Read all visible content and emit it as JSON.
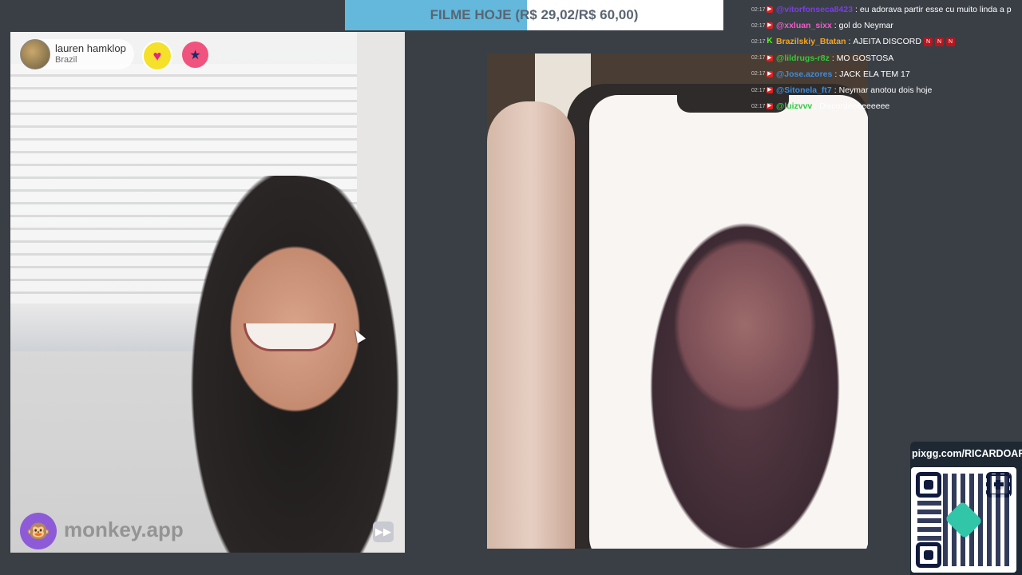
{
  "goal": {
    "text": "FILME HOJE (R$ 29,02/R$ 60,00)",
    "progress_fraction": 0.48,
    "fill_color": "#63b8dc"
  },
  "stranger": {
    "name": "lauren hamklop",
    "country": "Brazil",
    "avatar_icon": "monkey-avatar-icon",
    "heart_icon": "heart-icon",
    "report_icon": "police-icon"
  },
  "app": {
    "logo_icon": "monkey-logo-icon",
    "name": "monkey.app",
    "skip_icon": "skip-forward-icon"
  },
  "chat": [
    {
      "time": "02:17",
      "platform": "youtube",
      "user": "@vitorfonseca8423",
      "user_color": "#7b3fe0",
      "message": "eu adorava partir esse cu muito linda a p",
      "emotes": 0
    },
    {
      "time": "02:17",
      "platform": "youtube",
      "user": "@xxluan_sixx",
      "user_color": "#f25ac8",
      "message": "gol do Neymar",
      "emotes": 0
    },
    {
      "time": "02:17",
      "platform": "kick",
      "user": "Brazilskiy_Btatan",
      "user_color": "#f5a623",
      "message": "AJEITA DISCORD",
      "emotes": 3
    },
    {
      "time": "02:17",
      "platform": "youtube",
      "user": "@lildrugs-r8z",
      "user_color": "#2ecc40",
      "message": "MO GOSTOSA",
      "emotes": 0
    },
    {
      "time": "02:17",
      "platform": "youtube",
      "user": "@Jose.azores",
      "user_color": "#3c8dde",
      "message": "JACK ELA TEM 17",
      "emotes": 0
    },
    {
      "time": "02:17",
      "platform": "youtube",
      "user": "@Sitonela_ft7",
      "user_color": "#3c8dde",
      "message": "Neymar anotou dois hoje",
      "emotes": 0
    },
    {
      "time": "02:17",
      "platform": "youtube",
      "user": "@luizvvv",
      "user_color": "#2ecc40",
      "message": "Discordeeeeeeeee",
      "emotes": 0
    }
  ],
  "donation": {
    "url": "pixgg.com/RICARDOARA",
    "qr_icon": "qr-code-icon"
  }
}
